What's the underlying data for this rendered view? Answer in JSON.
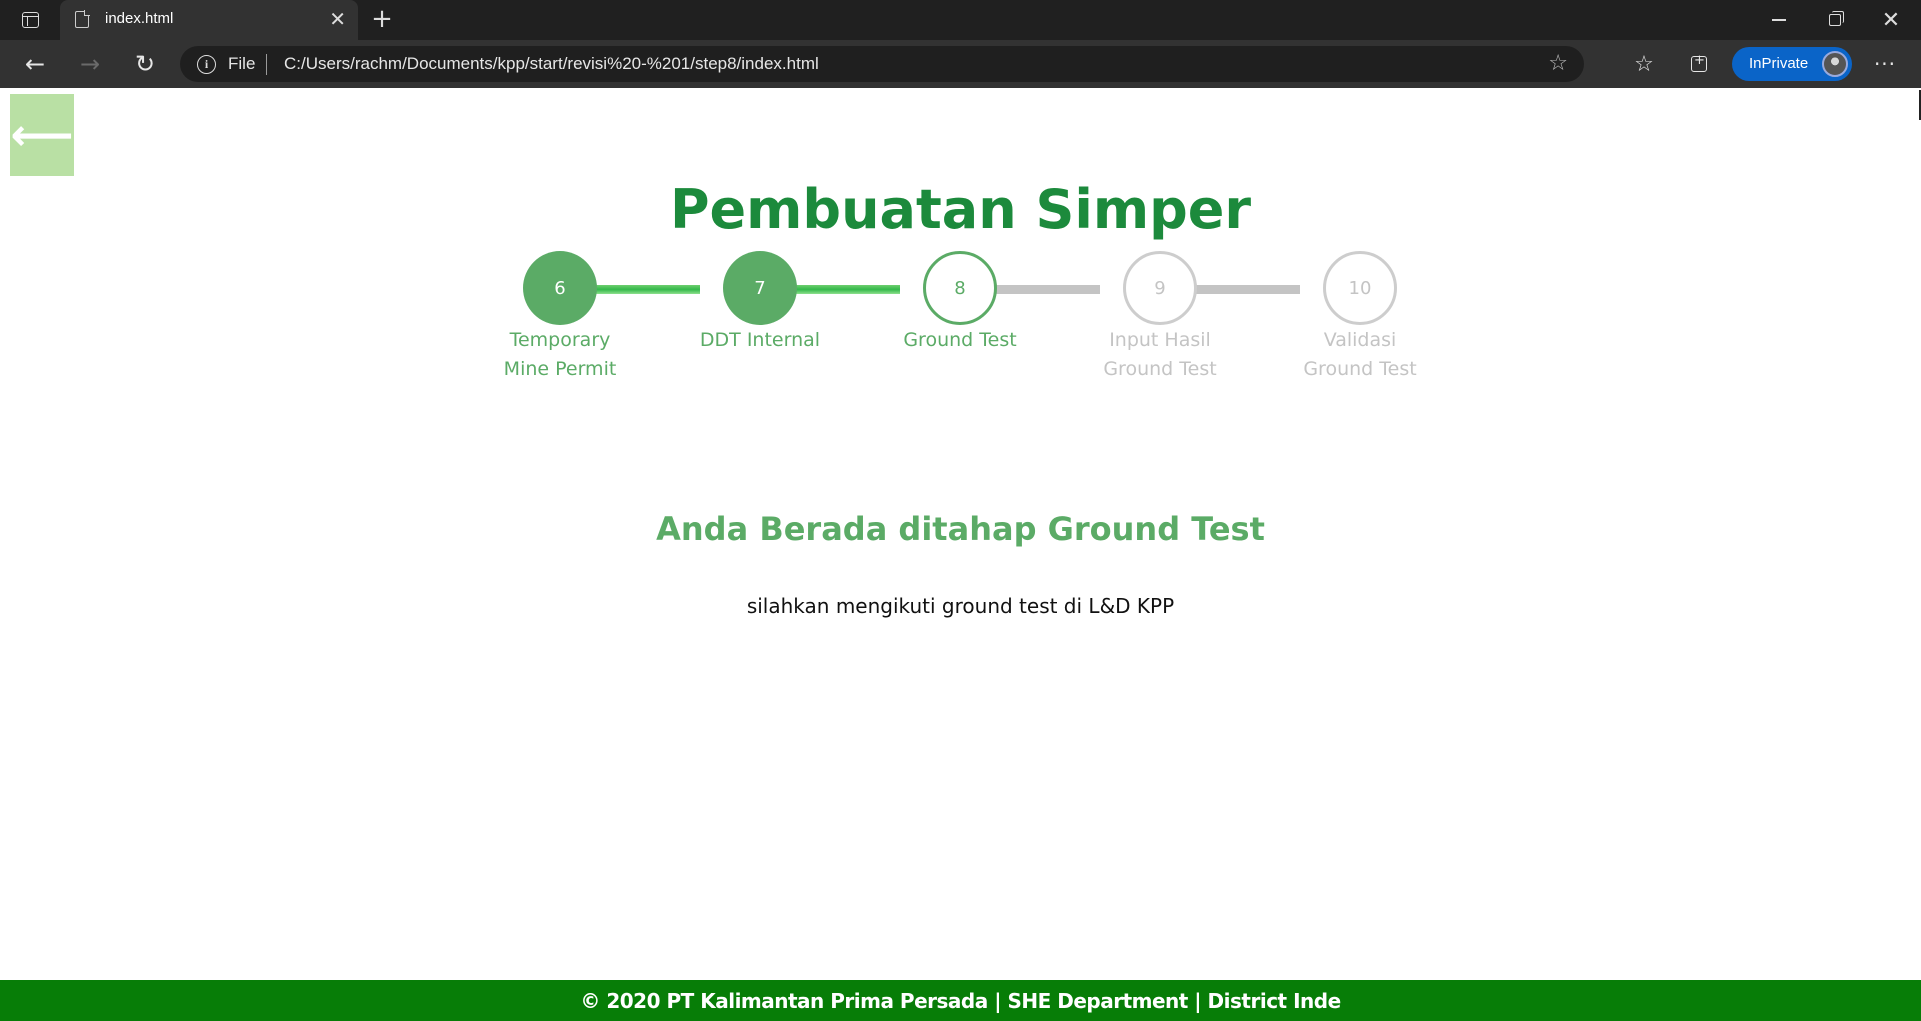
{
  "browser": {
    "tab_title": "index.html",
    "tab_close": "✕",
    "new_tab": "+",
    "address_scheme": "File",
    "address_url": "C:/Users/rachm/Documents/kpp/start/revisi%20-%201/step8/index.html",
    "profile_label": "InPrivate",
    "icons": [
      "tab-actions-icon",
      "file-icon",
      "close-icon",
      "plus-icon",
      "back-arrow-icon",
      "forward-arrow-icon",
      "reload-icon",
      "info-icon",
      "add-favorite-icon",
      "favorites-icon",
      "collections-icon",
      "avatar",
      "more-icon",
      "minimize-icon",
      "restore-icon",
      "window-close-icon"
    ]
  },
  "page": {
    "back_button_icon": "left-arrow-icon",
    "title": "Pembuatan Simper",
    "steps": [
      {
        "number": "6",
        "label_line1": "Temporary",
        "label_line2": "Mine Permit",
        "status": "done"
      },
      {
        "number": "7",
        "label_line1": "DDT Internal",
        "label_line2": "",
        "status": "done"
      },
      {
        "number": "8",
        "label_line1": "Ground Test",
        "label_line2": "",
        "status": "current"
      },
      {
        "number": "9",
        "label_line1": "Input Hasil",
        "label_line2": "Ground Test",
        "status": "todo"
      },
      {
        "number": "10",
        "label_line1": "Validasi",
        "label_line2": "Ground Test",
        "status": "todo"
      }
    ],
    "stage_heading": "Anda Berada ditahap Ground Test",
    "stage_text": "silahkan mengikuti ground test di L&D KPP",
    "footer": "© 2020 PT Kalimantan Prima Persada | SHE Department | District Inde"
  },
  "colors": {
    "brand_green": "#1c8a3c",
    "step_green": "#5bab66",
    "inactive_gray": "#c4c4c4",
    "footer_green": "#077d07",
    "back_button_bg": "#b9e0a4"
  }
}
